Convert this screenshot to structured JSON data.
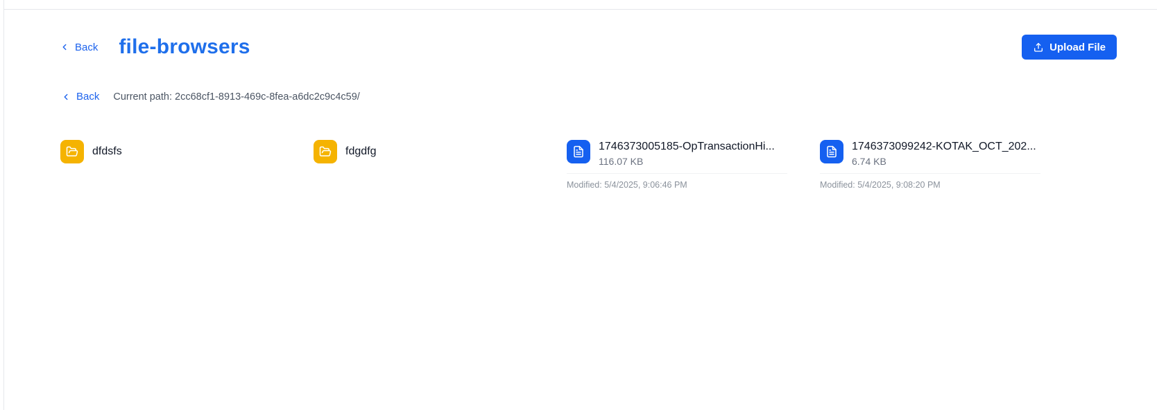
{
  "header": {
    "back_label": "Back",
    "title": "file-browsers",
    "upload_label": "Upload File"
  },
  "pathbar": {
    "back_label": "Back",
    "path_text": "Current path: 2cc68cf1-8913-469c-8fea-a6dc2c9c4c59/"
  },
  "items": [
    {
      "type": "folder",
      "name": "dfdsfs",
      "icon": "folder-open-icon"
    },
    {
      "type": "folder",
      "name": "fdgdfg",
      "icon": "folder-open-icon"
    },
    {
      "type": "file",
      "name": "1746373005185-OpTransactionHi...",
      "size": "116.07 KB",
      "modified": "Modified: 5/4/2025, 9:06:46 PM",
      "icon": "file-text-icon"
    },
    {
      "type": "file",
      "name": "1746373099242-KOTAK_OCT_202...",
      "size": "6.74 KB",
      "modified": "Modified: 5/4/2025, 9:08:20 PM",
      "icon": "file-text-icon"
    }
  ],
  "colors": {
    "accent": "#1560f0",
    "title": "#1f6feb",
    "folder": "#f5b301"
  }
}
